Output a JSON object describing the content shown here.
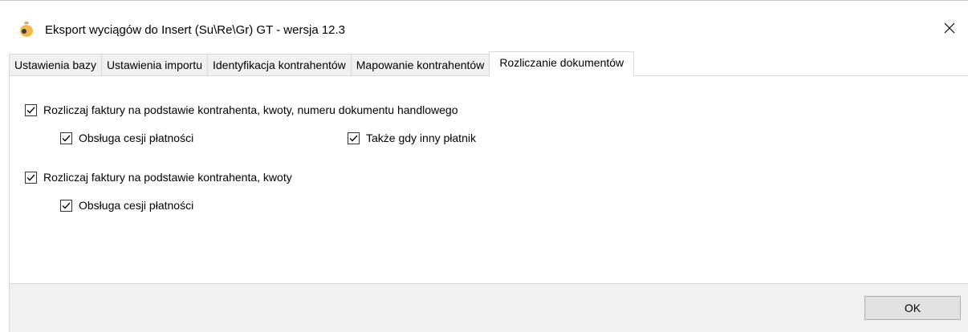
{
  "window": {
    "title": "Eksport wyciągów do Insert (Su\\Re\\Gr) GT - wersja 12.3",
    "icon": "money-bag-icon"
  },
  "tabs": [
    {
      "label": "Ustawienia bazy",
      "active": false
    },
    {
      "label": "Ustawienia importu",
      "active": false
    },
    {
      "label": "Identyfikacja kontrahentów",
      "active": false
    },
    {
      "label": "Mapowanie kontrahentów",
      "active": false
    },
    {
      "label": "Rozliczanie dokumentów",
      "active": true
    }
  ],
  "options": {
    "opt1": {
      "label": "Rozliczaj faktury na podstawie kontrahenta, kwoty, numeru dokumentu handlowego",
      "checked": true
    },
    "opt1_cesja": {
      "label": "Obsługa cesji płatności",
      "checked": true
    },
    "opt1_inny": {
      "label": "Także gdy inny płatnik",
      "checked": true
    },
    "opt2": {
      "label": "Rozliczaj faktury na podstawie kontrahenta, kwoty",
      "checked": true
    },
    "opt2_cesja": {
      "label": "Obsługa cesji płatności",
      "checked": true
    }
  },
  "footer": {
    "ok_label": "OK"
  },
  "colors": {
    "footer_bg": "#f0f0f0",
    "tab_border": "#d9d9d9",
    "button_bg": "#e1e1e1"
  }
}
